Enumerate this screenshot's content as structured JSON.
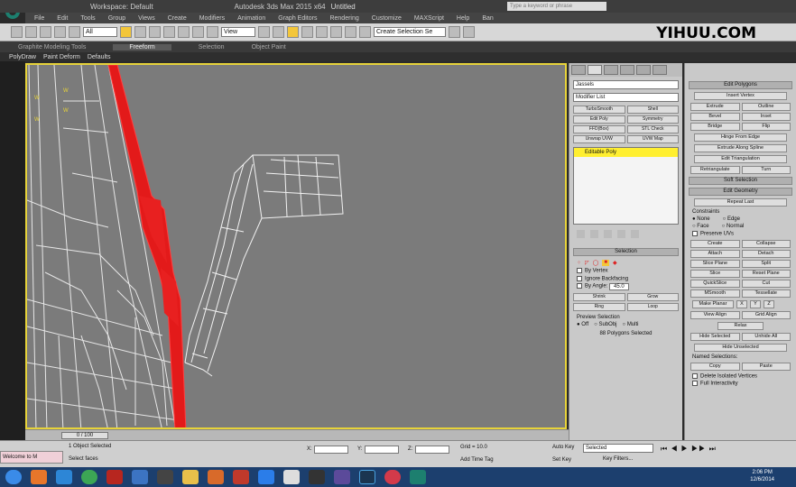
{
  "window": {
    "workspace": "Workspace: Default",
    "app_title": "Autodesk 3ds Max  2015 x64",
    "file_title": "Untitled",
    "search_placeholder": "Type a keyword or phrase"
  },
  "menu": [
    "File",
    "Edit",
    "Tools",
    "Group",
    "Views",
    "Create",
    "Modifiers",
    "Animation",
    "Graph Editors",
    "Rendering",
    "Customize",
    "MAXScript",
    "Help",
    "Ban"
  ],
  "toolbar": {
    "filter_select": "All",
    "view_select": "View",
    "named_selection": "Create Selection Se"
  },
  "watermark": "YIHUU.COM",
  "ribbon": {
    "tabs": [
      "Graphite Modeling Tools",
      "Freeform",
      "Selection",
      "Object Paint"
    ],
    "subtabs": [
      "PolyDraw",
      "Paint Deform",
      "Defaults"
    ]
  },
  "viewport": {
    "labels": [
      "W",
      "W",
      "W",
      "W"
    ]
  },
  "command_panel": {
    "object_name": "Jassels",
    "modifier_list": "Modifier List",
    "modifiers": [
      "TurboSmooth",
      "Shell",
      "Edit Poly",
      "Symmetry",
      "FFD(Box)",
      "STL Check",
      "Unwrap UVW",
      "UVW Map",
      "Editable Poly"
    ],
    "stack_item": "Editable Poly",
    "selection": {
      "title": "Selection",
      "by_vertex": "By Vertex",
      "ignore_backfacing": "Ignore Backfacing",
      "by_angle": "By Angle:",
      "angle_value": "45.0",
      "shrink": "Shrink",
      "grow": "Grow",
      "ring": "Ring",
      "loop": "Loop",
      "preview_selection": "Preview Selection",
      "off": "Off",
      "subobj": "SubObj",
      "multi": "Multi",
      "status": "88 Polygons Selected"
    }
  },
  "edit_polygons": {
    "title": "Edit Polygons",
    "insert_vertex": "Insert Vertex",
    "buttons": [
      "Extrude",
      "Outline",
      "Bevel",
      "Inset",
      "Bridge",
      "Flip"
    ],
    "hinge": "Hinge From Edge",
    "extrude_spline": "Extrude Along Spline",
    "edit_tri": "Edit Triangulation",
    "retriangulate": "Retriangulate",
    "turn": "Turn"
  },
  "soft_selection": "Soft Selection",
  "edit_geometry": {
    "title": "Edit Geometry",
    "repeat_last": "Repeat Last",
    "constraints": "Constraints",
    "none": "None",
    "edge": "Edge",
    "face": "Face",
    "normal": "Normal",
    "preserve_uvs": "Preserve UVs",
    "pairs": [
      "Create",
      "Collapse",
      "Attach",
      "Detach",
      "Slice Plane",
      "Split",
      "Slice",
      "Reset Plane",
      "QuickSlice",
      "Cut",
      "MSmooth",
      "Tessellate"
    ],
    "make_planar": "Make Planar",
    "axes": [
      "X",
      "Y",
      "Z"
    ],
    "view_align": "View Align",
    "grid_align": "Grid Align",
    "relax": "Relax",
    "hide_selected": "Hide Selected",
    "unhide_all": "Unhide All",
    "hide_unselected": "Hide Unselected",
    "named_selections": "Named Selections:",
    "copy": "Copy",
    "paste": "Paste",
    "delete_isolated": "Delete Isolated Vertices",
    "full_interactivity": "Full Interactivity"
  },
  "timeline": {
    "frame": "0 / 100"
  },
  "status": {
    "selected": "1 Object Selected",
    "prompt": "Select faces",
    "x": "X:",
    "y": "Y:",
    "z": "Z:",
    "grid": "Grid = 10.0",
    "add_time_tag": "Add Time Tag",
    "auto_key": "Auto Key",
    "set_key": "Set Key",
    "selected_select": "Selected",
    "key_filters": "Key Filters...",
    "maxscript": "Welcome to M"
  },
  "clock": {
    "time": "2:06 PM",
    "date": "12/6/2014"
  },
  "colors": {
    "viewport_bg": "#7b7b7b",
    "selection_red": "#e31a1a",
    "viewport_border": "#e7d33a",
    "stack_highlight": "#ffef30"
  }
}
